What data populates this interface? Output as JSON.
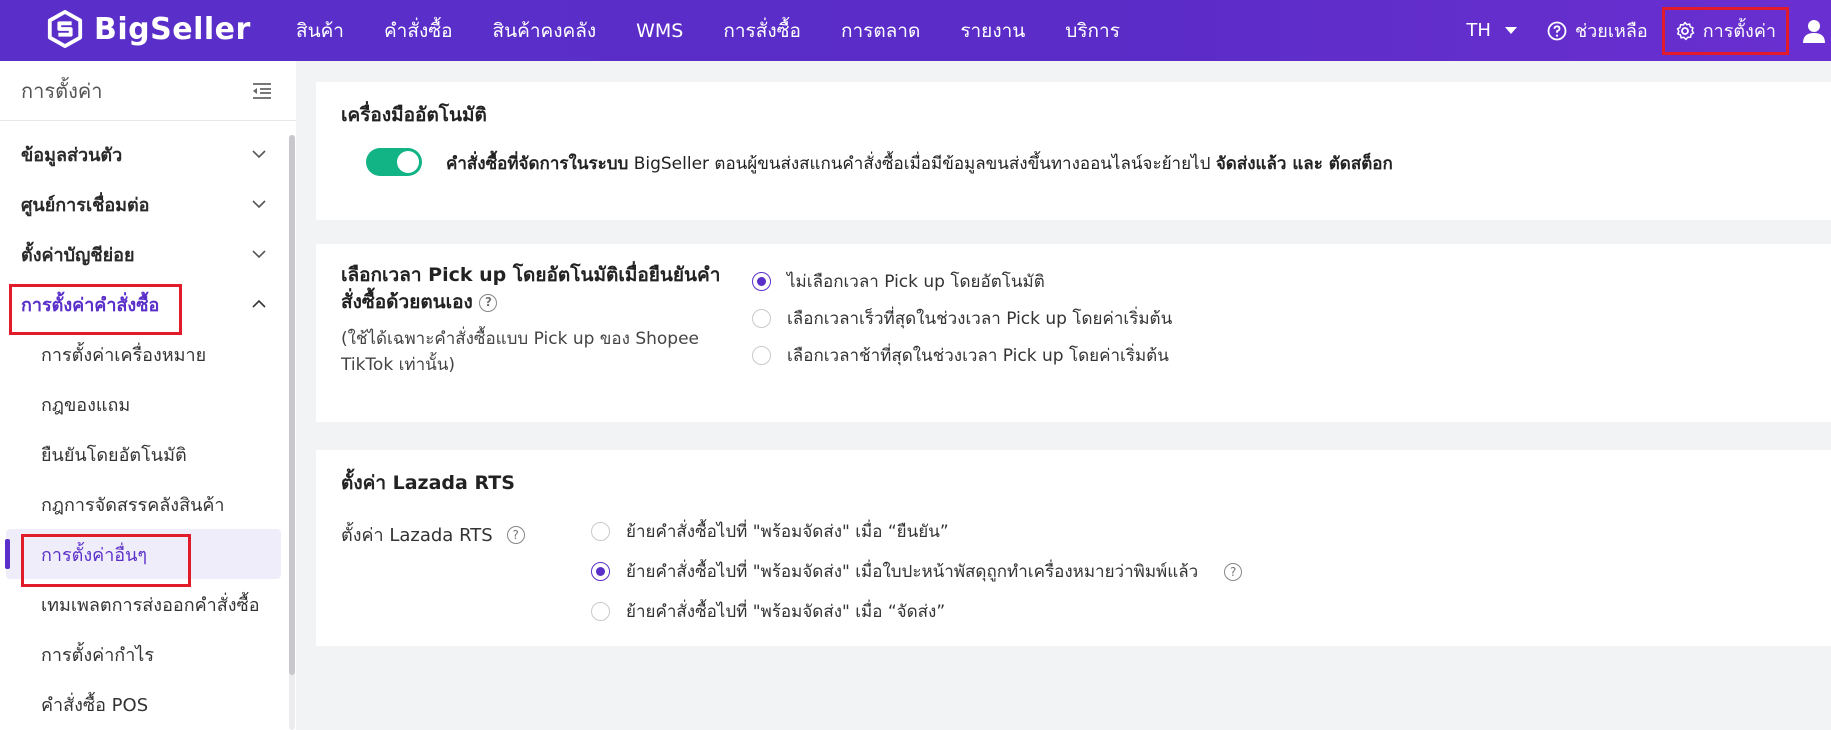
{
  "brand": {
    "name": "BigSeller"
  },
  "nav": [
    {
      "label": "สินค้า"
    },
    {
      "label": "คำสั่งซื้อ"
    },
    {
      "label": "สินค้าคงคลัง"
    },
    {
      "label": "WMS"
    },
    {
      "label": "การสั่งซื้อ"
    },
    {
      "label": "การตลาด"
    },
    {
      "label": "รายงาน"
    },
    {
      "label": "บริการ"
    }
  ],
  "topright": {
    "lang": "TH",
    "help": "ช่วยเหลือ",
    "settings": "การตั้งค่า"
  },
  "sidebar": {
    "title": "การตั้งค่า",
    "groups": [
      {
        "label": "ข้อมูลส่วนตัว"
      },
      {
        "label": "ศูนย์การเชื่อมต่อ"
      },
      {
        "label": "ตั้งค่าบัญชีย่อย"
      },
      {
        "label": "การตั้งค่าคำสั่งซื้อ"
      }
    ],
    "subs": [
      {
        "label": "การตั้งค่าเครื่องหมาย"
      },
      {
        "label": "กฎของแถม"
      },
      {
        "label": "ยืนยันโดยอัตโนมัติ"
      },
      {
        "label": "กฎการจัดสรรคลังสินค้า"
      },
      {
        "label": "การตั้งค่าอื่นๆ"
      },
      {
        "label": "เทมเพลตการส่งออกคำสั่งซื้อ"
      },
      {
        "label": "การตั้งค่ากำไร"
      },
      {
        "label": "คำสั่งซื้อ POS"
      }
    ]
  },
  "auto_tool": {
    "title": "เครื่องมืออัตโนมัติ",
    "text_prefix": "คำสั่งซื้อที่จัดการในระบบ",
    "text_middle": " BigSeller ตอนผู้ขนส่งสแกนคำสั่งซื้อเมื่อมีข้อมูลขนส่งขึ้นทางออนไลน์จะย้ายไป ",
    "text_bold1": "จัดส่งแล้ว",
    "text_and": " และ ",
    "text_bold2": "ตัดสต็อก",
    "enabled": true
  },
  "pickup": {
    "title": "เลือกเวลา Pick up โดยอัตโนมัติเมื่อยืนยันคำสั่งซื้อด้วยตนเอง",
    "note": "(ใช้ได้เฉพาะคำสั่งซื้อแบบ Pick up ของ Shopee TikTok เท่านั้น)",
    "options": [
      {
        "label": "ไม่เลือกเวลา Pick up โดยอัตโนมัติ",
        "selected": true
      },
      {
        "label": "เลือกเวลาเร็วที่สุดในช่วงเวลา Pick up โดยค่าเริ่มต้น",
        "selected": false
      },
      {
        "label": "เลือกเวลาช้าที่สุดในช่วงเวลา Pick up โดยค่าเริ่มต้น",
        "selected": false
      }
    ]
  },
  "lazada": {
    "title": "ตั้งค่า Lazada RTS",
    "label": "ตั้งค่า Lazada RTS",
    "options": [
      {
        "label": "ย้ายคำสั่งซื้อไปที่ \"พร้อมจัดส่ง\" เมื่อ “ยืนยัน”",
        "selected": false
      },
      {
        "label": "ย้ายคำสั่งซื้อไปที่ \"พร้อมจัดส่ง\" เมื่อใบปะหน้าพัสดุถูกทำเครื่องหมายว่าพิมพ์แล้ว",
        "selected": true
      },
      {
        "label": "ย้ายคำสั่งซื้อไปที่ \"พร้อมจัดส่ง\" เมื่อ “จัดส่ง”",
        "selected": false
      }
    ]
  },
  "colors": {
    "accent": "#5a2fc9",
    "toggle": "#12b385",
    "highlight": "#e21b2b"
  }
}
